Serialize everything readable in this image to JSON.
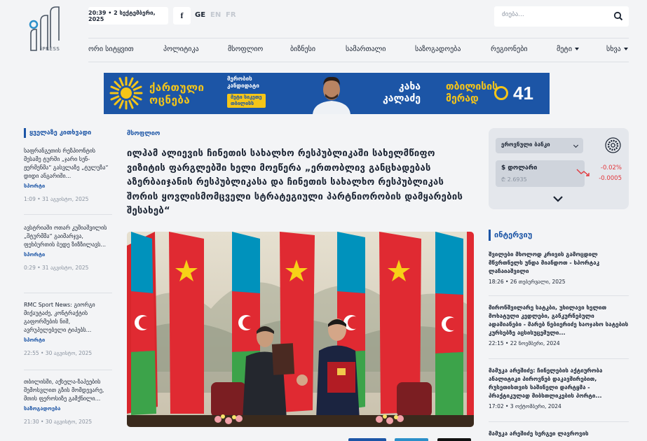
{
  "header": {
    "logo_text": "iPRESS",
    "datetime": "20:39 • 2 სექტემბერი, 2025",
    "social_facebook": "f",
    "languages": [
      {
        "code": "GE",
        "active": true
      },
      {
        "code": "EN",
        "active": false
      },
      {
        "code": "FR",
        "active": false
      }
    ],
    "search": {
      "placeholder": "ძიება..."
    }
  },
  "nav": {
    "items": [
      "ორი სიტყვით",
      "პოლიტიკა",
      "მსოფლიო",
      "ბიზნესი",
      "სამართალი",
      "საზოგადოება",
      "რეგიონები"
    ],
    "more": "მეტი",
    "other": "სხვა"
  },
  "banner": {
    "party_line1": "ქართული",
    "party_line2": "ოცნება",
    "small_line1": "მერობის",
    "small_line2": "კანდიდატი",
    "small_pill_line1": "მეტი სიკეთე",
    "small_pill_line2": "თბილისს",
    "name_line1": "კახა",
    "name_line2": "კალაძე",
    "city_line1": "თბილისის",
    "city_line2": "მერად",
    "number": "41",
    "colors": {
      "bg": "#1c55a6",
      "accent": "#f5c518"
    }
  },
  "left": {
    "title": "ყველაზე კითხვადი",
    "items": [
      {
        "title": "საფრანგეთის რეზპიონტის მესამე ტურში „ჯარი სენ-ჟერმენმა“ გასვლაზე „ტულუზა“ დიდი ანგარიში...",
        "category": "სპორტი",
        "date": "1:09 • 31 აგვისტო, 2025"
      },
      {
        "title": "ავსტრიაში ოთარ კუშიაშვილის „შტურმმა“ გაიმარჯვა, ფეხბურთის ბუდე ზიზზილავს...",
        "category": "სპორტი",
        "date": "0:29 • 31 აგვისტო, 2025"
      },
      {
        "title": "RMC Sport News: გიორგი მიქაუტაძე, კონტრაქტის გაფორმების ნიშ, ავრუპელებელი ტიპებს...",
        "category": "სპორტი",
        "date": "22:55 • 30 აგვისტო, 2025"
      },
      {
        "title": "თბილისში, აქსელა-ზაპეების შემოსვლით გზის მომდევარე, მთის ფეროსიზე გამქნილი...",
        "category": "საზოგადოება",
        "date": "21:30 • 30 აგვისტო, 2025"
      }
    ]
  },
  "article": {
    "category": "მსოფლიო",
    "title": "ილჰამ ალიევის ჩინეთის სახალხო რესპუბლიკაში სახელმწიფო ვიზიტის ფარგლებში ხელი მოეწერა „ერთობლივ განცხადებას აზერბაიჯანის რესპუბლიკასა და ჩინეთის სახალხო რესპუბლიკას შორის ყოვლისმომცველი სტრატეგიული პარტნიორობის დამყარების შესახებ“"
  },
  "currency": {
    "bank": "ეროვნული ბანკი",
    "currency_name": "$  დოლარი",
    "rate": "₾ 2.6935",
    "change_percent": "-0.02%",
    "change_abs": "-0.0005",
    "colors": {
      "negative": "#e2363b"
    }
  },
  "interview": {
    "title": "ინტერვიუ",
    "items": [
      {
        "title": "შვილები მხოლოდ კრივის გამოცდილ მწვრთნელს უნდა მიანდოთ - სპორტაკ ლაჩაიაშვილი",
        "date": "18:26 • 26 თებერვალი, 2025"
      },
      {
        "title": "მირონშვილარე სატკბი, უხილავი ხელით მოხატული კედლები, განკურნებული ადამიანები - მარებ ნებიერიძე საოჯახო სატების კურსებზე აცსისუცემული...",
        "date": "22:15 • 22 ნოემბერი, 2024"
      },
      {
        "title": "მამუკა არეშიძე: ჩინელების აქტიურობა ანალიტიკი პიროვნებ დაკავშირებით, რუსეთისთვის საშინელი დარტყმა - პრაქტიკულად მიბსთლიკების პორტი...",
        "date": "17:02 • 3 ოქტომბერი, 2024"
      },
      {
        "title": "მამუკა არეშიძე სერგეი ლავროვის",
        "date": ""
      }
    ]
  }
}
